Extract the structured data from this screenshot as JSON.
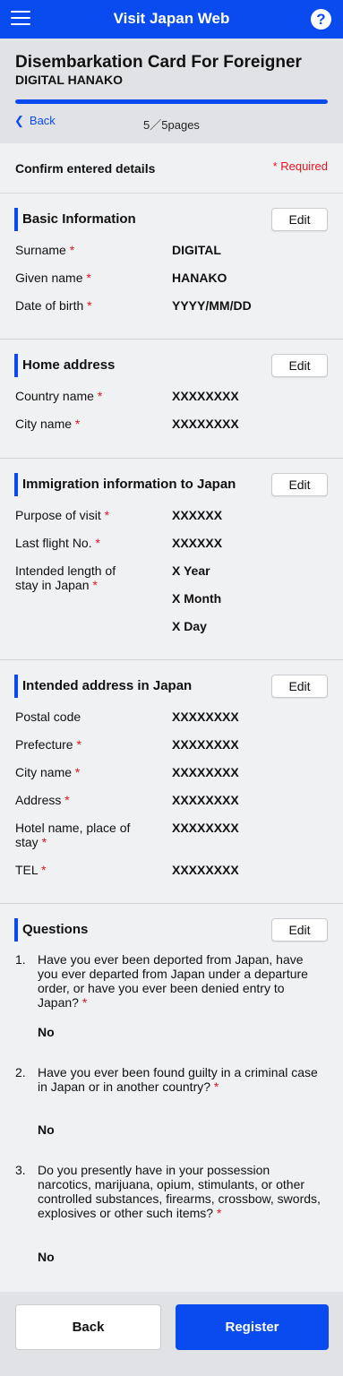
{
  "header": {
    "app_title": "Visit Japan Web",
    "help_label": "?"
  },
  "page": {
    "title": "Disembarkation Card For Foreigner",
    "subtitle": "DIGITAL HANAKO",
    "progress_fraction": 1.0,
    "back_label": "Back",
    "page_count": "5／5pages"
  },
  "confirm": {
    "title": "Confirm entered details",
    "required_note": "* Required"
  },
  "edit_label": "Edit",
  "required_mark": "*",
  "basic_info": {
    "title": "Basic Information",
    "surname_label": "Surname",
    "surname": "DIGITAL",
    "given_name_label": "Given name",
    "given_name": "HANAKO",
    "dob_label": "Date of birth",
    "dob": "YYYY/MM/DD"
  },
  "home_address": {
    "title": "Home address",
    "country_label": "Country name",
    "country": "XXXXXXXX",
    "city_label": "City name",
    "city": "XXXXXXXX"
  },
  "immigration": {
    "title": "Immigration information to Japan",
    "purpose_label": "Purpose of visit",
    "purpose": "XXXXXX",
    "flight_label": "Last flight No.",
    "flight": "XXXXXX",
    "stay_label_1": "Intended length of",
    "stay_label_2": "stay in Japan",
    "stay_year": "X Year",
    "stay_month": "X Month",
    "stay_day": "X Day"
  },
  "japan_address": {
    "title": "Intended address in Japan",
    "postal_label": "Postal code",
    "postal": "XXXXXXXX",
    "prefecture_label": "Prefecture",
    "prefecture": "XXXXXXXX",
    "city_label": "City name",
    "city": "XXXXXXXX",
    "address_label": "Address",
    "address": "XXXXXXXX",
    "hotel_label_1": "Hotel name, place of",
    "hotel_label_2": "stay",
    "hotel": "XXXXXXXX",
    "tel_label": "TEL",
    "tel": "XXXXXXXX"
  },
  "questions": {
    "title": "Questions",
    "items": [
      {
        "num": "1.",
        "text": "Have you ever been deported from Japan, have you ever departed from Japan under a departure order, or have you ever been denied entry to Japan?",
        "answer": "No"
      },
      {
        "num": "2.",
        "text": "Have you ever been found guilty in a criminal case in Japan or in another country?",
        "answer": "No"
      },
      {
        "num": "3.",
        "text": "Do you presently have in your possession narcotics, marijuana, opium, stimulants, or other controlled substances, firearms, crossbow, swords, explosives or other such items?",
        "answer": "No"
      }
    ]
  },
  "footer": {
    "back_label": "Back",
    "register_label": "Register"
  },
  "colors": {
    "brand_blue": "#0a4bf0",
    "required_red": "#e0141e"
  }
}
